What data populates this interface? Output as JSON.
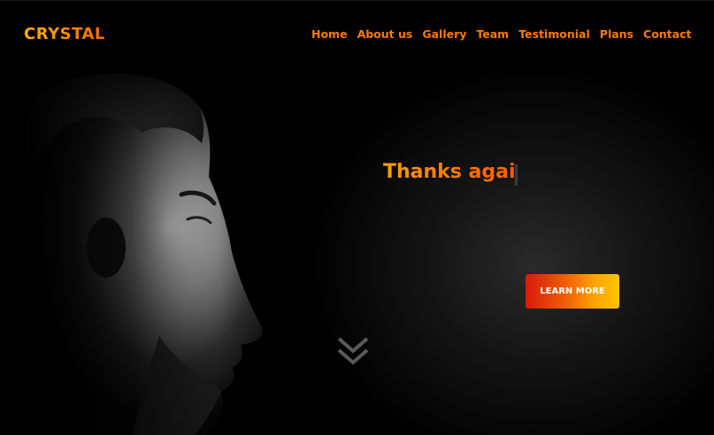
{
  "header": {
    "brand": "CRYSTAL",
    "nav": [
      {
        "label": "Home"
      },
      {
        "label": "About us"
      },
      {
        "label": "Gallery"
      },
      {
        "label": "Team"
      },
      {
        "label": "Testimonial"
      },
      {
        "label": "Plans"
      },
      {
        "label": "Contact"
      }
    ]
  },
  "hero": {
    "headline": "Thanks agai",
    "cta_label": "LEARN MORE",
    "scroll_icon": "double-chevron-down-icon"
  },
  "colors": {
    "accent": "#ff7a00",
    "background": "#000000",
    "cta_start": "#d81a0a",
    "cta_end": "#ffc400"
  }
}
